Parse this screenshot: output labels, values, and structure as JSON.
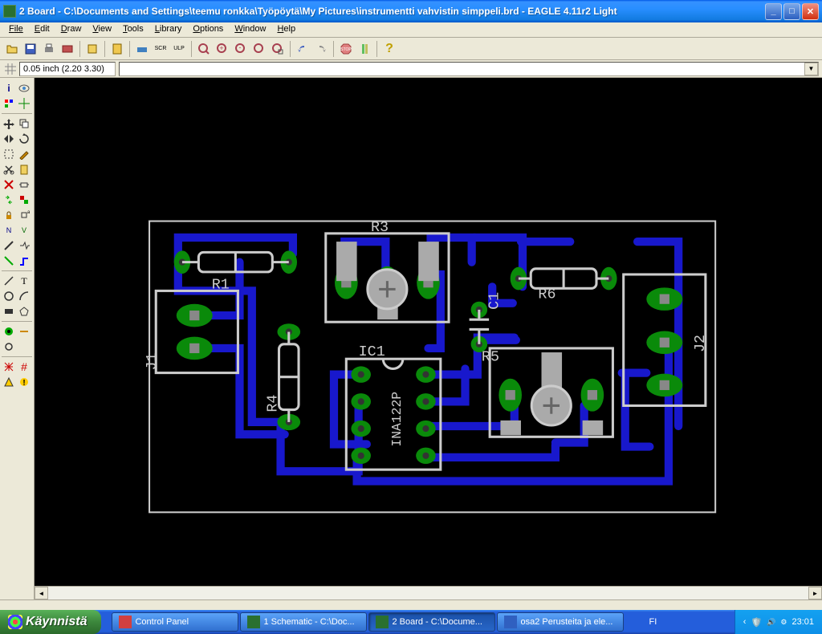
{
  "titlebar": {
    "text": "2 Board - C:\\Documents and Settings\\teemu ronkka\\Työpöytä\\My Pictures\\instrumentti vahvistin simppeli.brd - EAGLE 4.11r2 Light"
  },
  "menu": {
    "items": [
      "File",
      "Edit",
      "Draw",
      "View",
      "Tools",
      "Library",
      "Options",
      "Window",
      "Help"
    ]
  },
  "coord": {
    "value": "0.05 inch (2.20 3.30)"
  },
  "board": {
    "components": {
      "R1": "R1",
      "R3": "R3",
      "R4": "R4",
      "R5": "R5",
      "R6": "R6",
      "C1": "C1",
      "IC1": "IC1",
      "IC1_value": "INA122P",
      "J1": "J1",
      "J2": "J2"
    }
  },
  "taskbar": {
    "start": "Käynnistä",
    "items": [
      {
        "label": "Control Panel",
        "icon": "#d04040"
      },
      {
        "label": "1 Schematic - C:\\Doc...",
        "icon": "#2a7030"
      },
      {
        "label": "2 Board - C:\\Docume...",
        "icon": "#2a7030",
        "active": true
      },
      {
        "label": "osa2 Perusteita ja ele...",
        "icon": "#3060c0"
      }
    ],
    "lang": "FI",
    "clock": "23:01"
  }
}
